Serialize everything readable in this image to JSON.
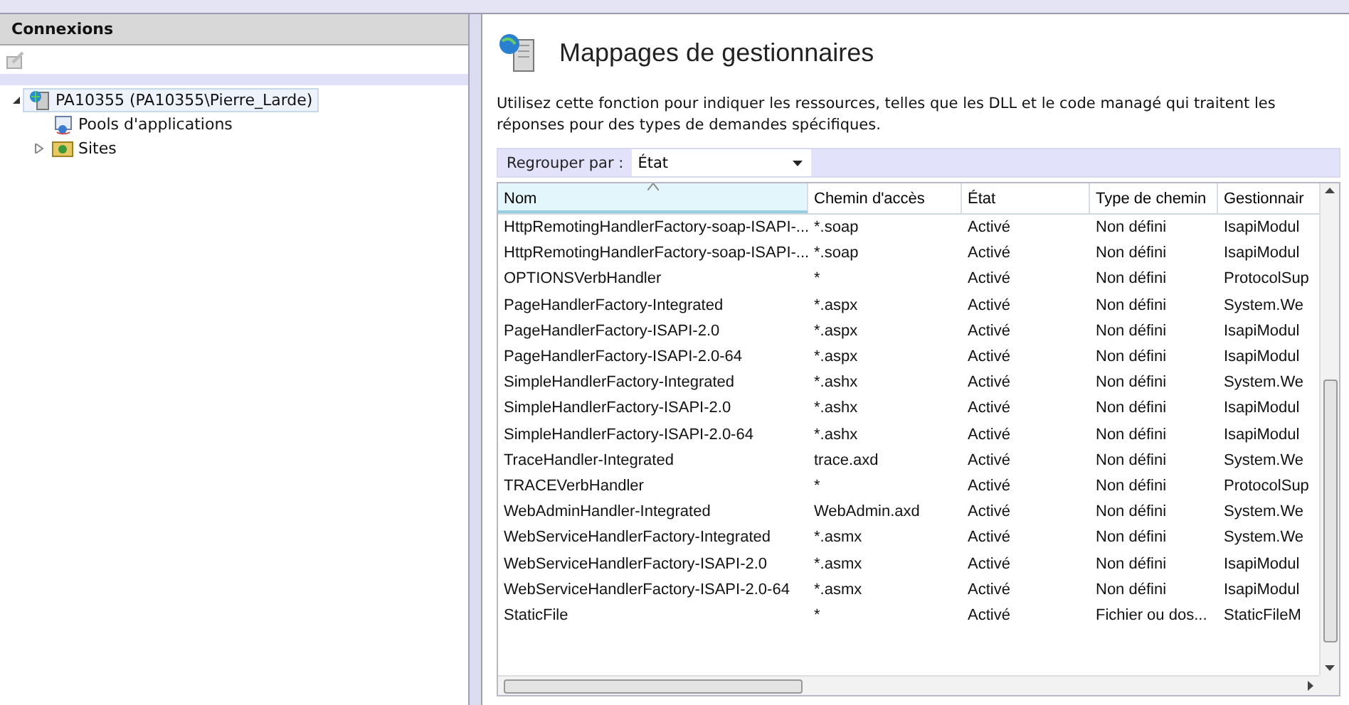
{
  "connections": {
    "title": "Connexions",
    "tree": [
      {
        "label": "PA10355 (PA10355\\Pierre_Larde)",
        "kind": "server",
        "expanded": true,
        "selected": true,
        "children": [
          {
            "label": "Pools d'applications",
            "kind": "pool",
            "selected": false
          },
          {
            "label": "Sites",
            "kind": "sites",
            "expanded": false,
            "selected": false
          }
        ]
      }
    ]
  },
  "feature": {
    "title": "Mappages de gestionnaires",
    "description": "Utilisez cette fonction pour indiquer les ressources, telles que les DLL et le code managé qui traitent les réponses pour des types de demandes spécifiques.",
    "group_by": {
      "label": "Regrouper par :",
      "value": "État"
    },
    "table": {
      "columns": [
        {
          "label": "Nom",
          "sorted": true
        },
        {
          "label": "Chemin d'accès",
          "sorted": false
        },
        {
          "label": "État",
          "sorted": false
        },
        {
          "label": "Type de chemin",
          "sorted": false
        },
        {
          "label": "Gestionnair",
          "sorted": false
        }
      ],
      "rows": [
        [
          "HttpRemotingHandlerFactory-soap-ISAPI-...",
          "*.soap",
          "Activé",
          "Non défini",
          "IsapiModul"
        ],
        [
          "HttpRemotingHandlerFactory-soap-ISAPI-...",
          "*.soap",
          "Activé",
          "Non défini",
          "IsapiModul"
        ],
        [
          "OPTIONSVerbHandler",
          "*",
          "Activé",
          "Non défini",
          "ProtocolSup"
        ],
        [
          "PageHandlerFactory-Integrated",
          "*.aspx",
          "Activé",
          "Non défini",
          "System.We"
        ],
        [
          "PageHandlerFactory-ISAPI-2.0",
          "*.aspx",
          "Activé",
          "Non défini",
          "IsapiModul"
        ],
        [
          "PageHandlerFactory-ISAPI-2.0-64",
          "*.aspx",
          "Activé",
          "Non défini",
          "IsapiModul"
        ],
        [
          "SimpleHandlerFactory-Integrated",
          "*.ashx",
          "Activé",
          "Non défini",
          "System.We"
        ],
        [
          "SimpleHandlerFactory-ISAPI-2.0",
          "*.ashx",
          "Activé",
          "Non défini",
          "IsapiModul"
        ],
        [
          "SimpleHandlerFactory-ISAPI-2.0-64",
          "*.ashx",
          "Activé",
          "Non défini",
          "IsapiModul"
        ],
        [
          "TraceHandler-Integrated",
          "trace.axd",
          "Activé",
          "Non défini",
          "System.We"
        ],
        [
          "TRACEVerbHandler",
          "*",
          "Activé",
          "Non défini",
          "ProtocolSup"
        ],
        [
          "WebAdminHandler-Integrated",
          "WebAdmin.axd",
          "Activé",
          "Non défini",
          "System.We"
        ],
        [
          "WebServiceHandlerFactory-Integrated",
          "*.asmx",
          "Activé",
          "Non défini",
          "System.We"
        ],
        [
          "WebServiceHandlerFactory-ISAPI-2.0",
          "*.asmx",
          "Activé",
          "Non défini",
          "IsapiModul"
        ],
        [
          "WebServiceHandlerFactory-ISAPI-2.0-64",
          "*.asmx",
          "Activé",
          "Non défini",
          "IsapiModul"
        ],
        [
          "StaticFile",
          "*",
          "Activé",
          "Fichier ou dos...",
          "StaticFileM"
        ]
      ]
    }
  }
}
